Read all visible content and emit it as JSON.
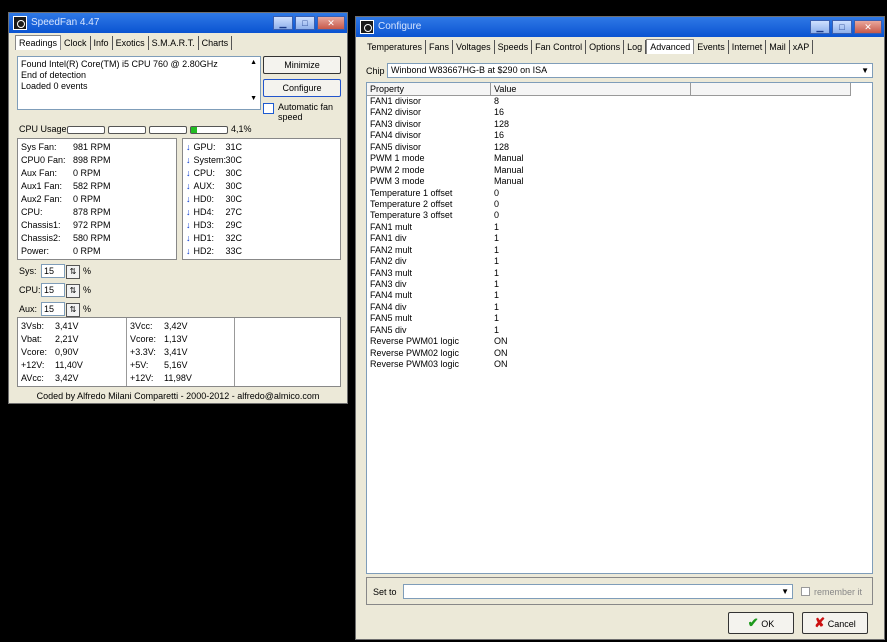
{
  "speedfan": {
    "title": "SpeedFan 4.47",
    "tabs": [
      "Readings",
      "Clock",
      "Info",
      "Exotics",
      "S.M.A.R.T.",
      "Charts"
    ],
    "log_lines": [
      "Found Intel(R) Core(TM) i5 CPU 760 @ 2.80GHz",
      "End of detection",
      "Loaded 0 events"
    ],
    "buttons": {
      "minimize": "Minimize",
      "configure": "Configure"
    },
    "auto_fan_label": "Automatic fan speed",
    "cpu_usage_label": "CPU Usage",
    "cpu_usage_value": "4,1%",
    "cpu_usage_fraction": 0.041,
    "fans": [
      {
        "label": "Sys Fan:",
        "value": "981 RPM"
      },
      {
        "label": "CPU0 Fan:",
        "value": "898 RPM"
      },
      {
        "label": "Aux Fan:",
        "value": "0 RPM"
      },
      {
        "label": "Aux1 Fan:",
        "value": "582 RPM"
      },
      {
        "label": "Aux2 Fan:",
        "value": "0 RPM"
      },
      {
        "label": "CPU:",
        "value": "878 RPM"
      },
      {
        "label": "Chassis1:",
        "value": "972 RPM"
      },
      {
        "label": "Chassis2:",
        "value": "580 RPM"
      },
      {
        "label": "Power:",
        "value": "0 RPM"
      }
    ],
    "temps": [
      {
        "label": "GPU:",
        "value": "31C"
      },
      {
        "label": "System:",
        "value": "30C"
      },
      {
        "label": "CPU:",
        "value": "30C"
      },
      {
        "label": "AUX:",
        "value": "30C"
      },
      {
        "label": "HD0:",
        "value": "30C"
      },
      {
        "label": "HD4:",
        "value": "27C"
      },
      {
        "label": "HD3:",
        "value": "29C"
      },
      {
        "label": "HD1:",
        "value": "32C"
      },
      {
        "label": "HD2:",
        "value": "33C"
      }
    ],
    "speeds": [
      {
        "label": "Sys:",
        "value": "15",
        "unit": "%"
      },
      {
        "label": "CPU:",
        "value": "15",
        "unit": "%"
      },
      {
        "label": "Aux:",
        "value": "15",
        "unit": "%"
      }
    ],
    "voltages_left": [
      {
        "label": "3Vsb:",
        "value": "3,41V"
      },
      {
        "label": "Vbat:",
        "value": "2,21V"
      },
      {
        "label": "Vcore:",
        "value": "0,90V"
      },
      {
        "label": "+12V:",
        "value": "11,40V"
      },
      {
        "label": "AVcc:",
        "value": "3,42V"
      }
    ],
    "voltages_right": [
      {
        "label": "3Vcc:",
        "value": "3,42V"
      },
      {
        "label": "Vcore:",
        "value": "1,13V"
      },
      {
        "label": "+3.3V:",
        "value": "3,41V"
      },
      {
        "label": "+5V:",
        "value": "5,16V"
      },
      {
        "label": "+12V:",
        "value": "11,98V"
      }
    ],
    "footer": "Coded by Alfredo Milani Comparetti - 2000-2012 - alfredo@almico.com"
  },
  "configure": {
    "title": "Configure",
    "tabs": [
      "Temperatures",
      "Fans",
      "Voltages",
      "Speeds",
      "Fan Control",
      "Options",
      "Log",
      "Advanced",
      "Events",
      "Internet",
      "Mail",
      "xAP"
    ],
    "active_tab": "Advanced",
    "chip_label": "Chip",
    "chip_value": "Winbond W83667HG-B at $290 on ISA",
    "columns": [
      "Property",
      "Value"
    ],
    "properties": [
      {
        "name": "FAN1 divisor",
        "value": "8"
      },
      {
        "name": "FAN2 divisor",
        "value": "16"
      },
      {
        "name": "FAN3 divisor",
        "value": "128"
      },
      {
        "name": "FAN4 divisor",
        "value": "16"
      },
      {
        "name": "FAN5 divisor",
        "value": "128"
      },
      {
        "name": "PWM 1 mode",
        "value": "Manual"
      },
      {
        "name": "PWM 2 mode",
        "value": "Manual"
      },
      {
        "name": "PWM 3 mode",
        "value": "Manual"
      },
      {
        "name": "Temperature 1 offset",
        "value": "0"
      },
      {
        "name": "Temperature 2 offset",
        "value": "0"
      },
      {
        "name": "Temperature 3 offset",
        "value": "0"
      },
      {
        "name": "FAN1 mult",
        "value": "1"
      },
      {
        "name": "FAN1 div",
        "value": "1"
      },
      {
        "name": "FAN2 mult",
        "value": "1"
      },
      {
        "name": "FAN2 div",
        "value": "1"
      },
      {
        "name": "FAN3 mult",
        "value": "1"
      },
      {
        "name": "FAN3 div",
        "value": "1"
      },
      {
        "name": "FAN4 mult",
        "value": "1"
      },
      {
        "name": "FAN4 div",
        "value": "1"
      },
      {
        "name": "FAN5 mult",
        "value": "1"
      },
      {
        "name": "FAN5 div",
        "value": "1"
      },
      {
        "name": "Reverse PWM01 logic",
        "value": "ON"
      },
      {
        "name": "Reverse PWM02 logic",
        "value": "ON"
      },
      {
        "name": "Reverse PWM03 logic",
        "value": "ON"
      }
    ],
    "set_to_label": "Set to",
    "set_to_value": "",
    "remember_label": "remember it",
    "ok_label": "OK",
    "cancel_label": "Cancel"
  }
}
